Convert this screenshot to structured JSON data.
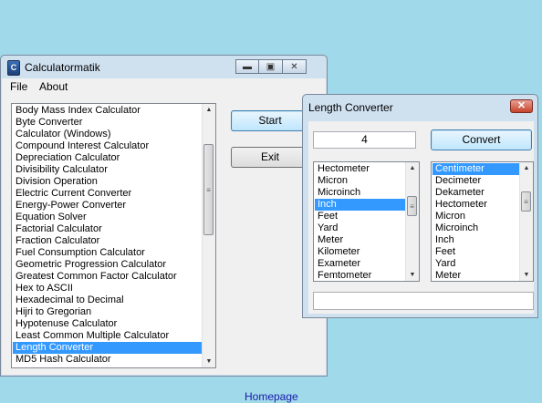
{
  "main_window": {
    "title": "Calculatormatik",
    "app_icon_glyph": "C",
    "menu": [
      "File",
      "About"
    ],
    "caption_icons": [
      "minimize-icon",
      "maximize-icon",
      "close-icon"
    ],
    "calculators": [
      "Body Mass Index Calculator",
      "Byte Converter",
      "Calculator (Windows)",
      "Compound Interest Calculator",
      "Depreciation Calculator",
      "Divisibility Calculator",
      "Division Operation",
      "Electric Current Converter",
      "Energy-Power Converter",
      "Equation Solver",
      "Factorial Calculator",
      "Fraction Calculator",
      "Fuel Consumption Calculator",
      "Geometric Progression Calculator",
      "Greatest Common Factor Calculator",
      "Hex to ASCII",
      "Hexadecimal to Decimal",
      "Hijri to Gregorian",
      "Hypotenuse Calculator",
      "Least Common Multiple Calculator",
      "Length Converter",
      "MD5 Hash Calculator"
    ],
    "selected_calculator": "Length Converter",
    "start_label": "Start",
    "exit_label": "Exit",
    "homepage_label": "Homepage"
  },
  "length_converter": {
    "title": "Length Converter",
    "input_value": "4",
    "convert_label": "Convert",
    "result_value": "",
    "from_units": [
      "Hectometer",
      "Micron",
      "Microinch",
      "Inch",
      "Feet",
      "Yard",
      "Meter",
      "Kilometer",
      "Exameter",
      "Femtometer"
    ],
    "from_selected": "Inch",
    "to_units": [
      "Centimeter",
      "Decimeter",
      "Dekameter",
      "Hectometer",
      "Micron",
      "Microinch",
      "Inch",
      "Feet",
      "Yard",
      "Meter"
    ],
    "to_selected": "Centimeter"
  },
  "colors": {
    "desktop": "#9fd9ea",
    "window_frame": "#cfe0ef",
    "selection": "#3399ff",
    "link": "#1a1aa6",
    "close_button": "#c7432b"
  }
}
